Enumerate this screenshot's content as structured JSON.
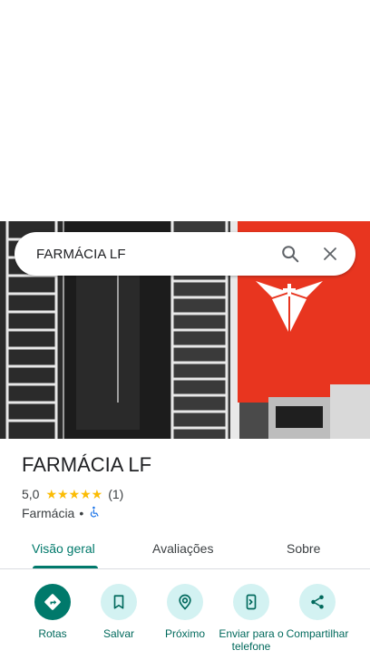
{
  "search": {
    "query": "FARMÁCIA LF"
  },
  "place": {
    "name": "FARMÁCIA LF",
    "rating": "5,0",
    "stars": "★★★★★",
    "review_count": "(1)",
    "category": "Farmácia",
    "separator": "•",
    "accessibility_icon": "wheelchair-icon"
  },
  "tabs": [
    {
      "label": "Visão geral",
      "active": true
    },
    {
      "label": "Avaliações",
      "active": false
    },
    {
      "label": "Sobre",
      "active": false
    }
  ],
  "actions": [
    {
      "label": "Rotas",
      "icon": "directions-icon"
    },
    {
      "label": "Salvar",
      "icon": "bookmark-icon"
    },
    {
      "label": "Próximo",
      "icon": "nearby-icon"
    },
    {
      "label": "Enviar para o telefone",
      "icon": "send-to-phone-icon"
    },
    {
      "label": "Compartilhar",
      "icon": "share-icon"
    }
  ],
  "colors": {
    "accent": "#00796b",
    "action_bg": "#d3f2f2",
    "star": "#fbbc04",
    "accessibility": "#1a73e8"
  }
}
